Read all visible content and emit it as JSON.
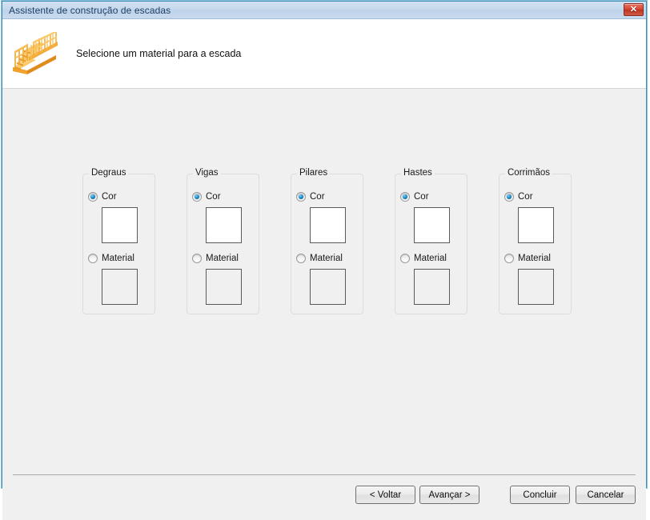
{
  "window": {
    "title": "Assistente de construção de escadas",
    "close_label": "✕",
    "close_icon": "close-icon"
  },
  "header": {
    "icon": "staircase-icon",
    "instruction": "Selecione um material para a escada"
  },
  "groups": [
    {
      "title": "Degraus",
      "color_option": {
        "label": "Cor",
        "selected": true,
        "swatch_color": "#ffffff"
      },
      "material_option": {
        "label": "Material",
        "selected": false,
        "swatch_color": "transparent"
      }
    },
    {
      "title": "Vigas",
      "color_option": {
        "label": "Cor",
        "selected": true,
        "swatch_color": "#ffffff"
      },
      "material_option": {
        "label": "Material",
        "selected": false,
        "swatch_color": "transparent"
      }
    },
    {
      "title": "Pilares",
      "color_option": {
        "label": "Cor",
        "selected": true,
        "swatch_color": "#ffffff"
      },
      "material_option": {
        "label": "Material",
        "selected": false,
        "swatch_color": "transparent"
      }
    },
    {
      "title": "Hastes",
      "color_option": {
        "label": "Cor",
        "selected": true,
        "swatch_color": "#ffffff"
      },
      "material_option": {
        "label": "Material",
        "selected": false,
        "swatch_color": "transparent"
      }
    },
    {
      "title": "Corrimãos",
      "color_option": {
        "label": "Cor",
        "selected": true,
        "swatch_color": "#ffffff"
      },
      "material_option": {
        "label": "Material",
        "selected": false,
        "swatch_color": "transparent"
      }
    }
  ],
  "footer": {
    "back_label": "< Voltar",
    "next_label": "Avançar >",
    "finish_label": "Concluir",
    "cancel_label": "Cancelar"
  },
  "colors": {
    "titlebar": "#c6d8ec",
    "body_background": "#f0f0f0",
    "header_background": "#ffffff",
    "window_border": "#3f8fb5",
    "close_button": "#bf3220",
    "radio_accent": "#1d8fd0",
    "icon_orange": "#f5a623"
  }
}
